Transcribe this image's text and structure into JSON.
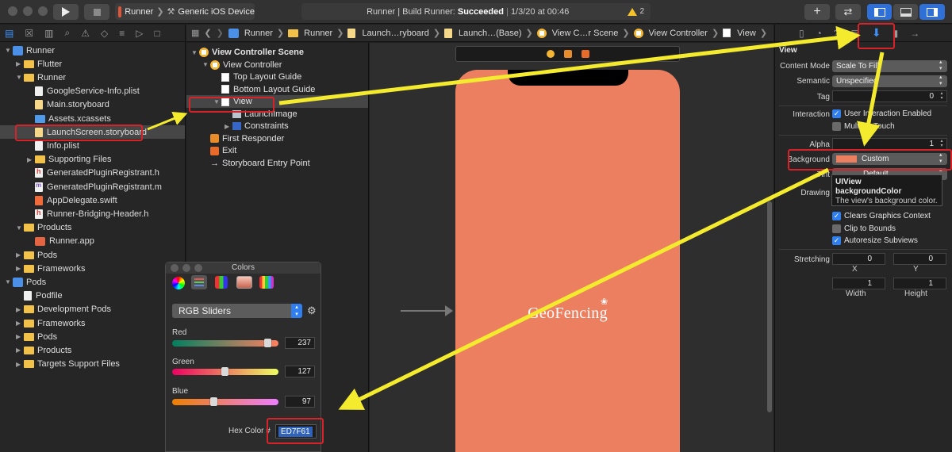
{
  "toolbar": {
    "scheme_app": "Runner",
    "scheme_device": "Generic iOS Device",
    "activity_prefix": "Runner | Build Runner: ",
    "activity_status": "Succeeded",
    "activity_time": "1/3/20 at 00:46",
    "warning_count": "2"
  },
  "navigator": {
    "rows": [
      {
        "label": "Runner",
        "indent": 0,
        "kind": "project",
        "disc": "▼"
      },
      {
        "label": "Flutter",
        "indent": 1,
        "kind": "folder",
        "disc": "▶"
      },
      {
        "label": "Runner",
        "indent": 1,
        "kind": "folder",
        "disc": "▼"
      },
      {
        "label": "GoogleService-Info.plist",
        "indent": 2,
        "kind": "doc",
        "disc": ""
      },
      {
        "label": "Main.storyboard",
        "indent": 2,
        "kind": "sb",
        "disc": ""
      },
      {
        "label": "Assets.xcassets",
        "indent": 2,
        "kind": "bluefolder",
        "disc": ""
      },
      {
        "label": "LaunchScreen.storyboard",
        "indent": 2,
        "kind": "sb",
        "disc": "",
        "selected": true
      },
      {
        "label": "Info.plist",
        "indent": 2,
        "kind": "doc",
        "disc": ""
      },
      {
        "label": "Supporting Files",
        "indent": 2,
        "kind": "folder",
        "disc": "▶"
      },
      {
        "label": "GeneratedPluginRegistrant.h",
        "indent": 2,
        "kind": "h",
        "disc": ""
      },
      {
        "label": "GeneratedPluginRegistrant.m",
        "indent": 2,
        "kind": "m",
        "disc": ""
      },
      {
        "label": "AppDelegate.swift",
        "indent": 2,
        "kind": "swift",
        "disc": ""
      },
      {
        "label": "Runner-Bridging-Header.h",
        "indent": 2,
        "kind": "h",
        "disc": ""
      },
      {
        "label": "Products",
        "indent": 1,
        "kind": "folder",
        "disc": "▼"
      },
      {
        "label": "Runner.app",
        "indent": 2,
        "kind": "app",
        "disc": ""
      },
      {
        "label": "Pods",
        "indent": 1,
        "kind": "folder",
        "disc": "▶"
      },
      {
        "label": "Frameworks",
        "indent": 1,
        "kind": "folder",
        "disc": "▶"
      },
      {
        "label": "Pods",
        "indent": 0,
        "kind": "project",
        "disc": "▼"
      },
      {
        "label": "Podfile",
        "indent": 1,
        "kind": "doc",
        "disc": ""
      },
      {
        "label": "Development Pods",
        "indent": 1,
        "kind": "folder",
        "disc": "▶"
      },
      {
        "label": "Frameworks",
        "indent": 1,
        "kind": "folder",
        "disc": "▶"
      },
      {
        "label": "Pods",
        "indent": 1,
        "kind": "folder",
        "disc": "▶"
      },
      {
        "label": "Products",
        "indent": 1,
        "kind": "folder",
        "disc": "▶"
      },
      {
        "label": "Targets Support Files",
        "indent": 1,
        "kind": "folder",
        "disc": "▶"
      }
    ]
  },
  "jumpbar": {
    "crumbs": [
      "Runner",
      "Runner",
      "Launch…ryboard",
      "Launch…(Base)",
      "View C…r Scene",
      "View Controller",
      "View"
    ]
  },
  "outline": {
    "rows": [
      {
        "label": "View Controller Scene",
        "indent": 0,
        "kind": "scene",
        "disc": "▼"
      },
      {
        "label": "View Controller",
        "indent": 1,
        "kind": "vc",
        "disc": "▼"
      },
      {
        "label": "Top Layout Guide",
        "indent": 2,
        "kind": "view",
        "disc": ""
      },
      {
        "label": "Bottom Layout Guide",
        "indent": 2,
        "kind": "view",
        "disc": ""
      },
      {
        "label": "View",
        "indent": 2,
        "kind": "view",
        "disc": "▼",
        "selected": true
      },
      {
        "label": "LaunchImage",
        "indent": 3,
        "kind": "img",
        "disc": ""
      },
      {
        "label": "Constraints",
        "indent": 3,
        "kind": "cons",
        "disc": "▶"
      },
      {
        "label": "First Responder",
        "indent": 1,
        "kind": "fr",
        "disc": ""
      },
      {
        "label": "Exit",
        "indent": 1,
        "kind": "exit",
        "disc": ""
      },
      {
        "label": "Storyboard Entry Point",
        "indent": 1,
        "kind": "entry",
        "disc": ""
      }
    ]
  },
  "canvas": {
    "launch_text": "GeoFencing",
    "background_color": "#ED7F61"
  },
  "inspector": {
    "section": "View",
    "content_mode_label": "Content Mode",
    "content_mode_value": "Scale To Fill",
    "semantic_label": "Semantic",
    "semantic_value": "Unspecified",
    "tag_label": "Tag",
    "tag_value": "0",
    "interaction_label": "Interaction",
    "user_interaction": "User Interaction Enabled",
    "multiple_touch": "Multiple Touch",
    "alpha_label": "Alpha",
    "alpha_value": "1",
    "background_label": "Background",
    "background_value": "Custom",
    "tint_label": "Tint",
    "tint_value": "Default",
    "drawing_label": "Drawing",
    "clears_graphics": "Clears Graphics Context",
    "clip_to_bounds": "Clip to Bounds",
    "autoresize": "Autoresize Subviews",
    "stretching_label": "Stretching",
    "stretch_x_value": "0",
    "stretch_y_value": "0",
    "x_caption": "X",
    "y_caption": "Y",
    "stretch_w_value": "1",
    "stretch_h_value": "1",
    "width_caption": "Width",
    "height_caption": "Height",
    "tooltip_line1": "UIView",
    "tooltip_line2": "backgroundColor",
    "tooltip_line3": "The view's background color."
  },
  "colors_panel": {
    "title": "Colors",
    "mode": "RGB Sliders",
    "red_label": "Red",
    "red_value": "237",
    "green_label": "Green",
    "green_value": "127",
    "blue_label": "Blue",
    "blue_value": "97",
    "hex_label": "Hex Color #",
    "hex_value": "ED7F61"
  },
  "colors": {
    "accent": "#2F7FF0",
    "annotation_arrow": "#F5EB2E",
    "annotation_box": "#D6232A",
    "launch_background": "#ED7F61"
  }
}
